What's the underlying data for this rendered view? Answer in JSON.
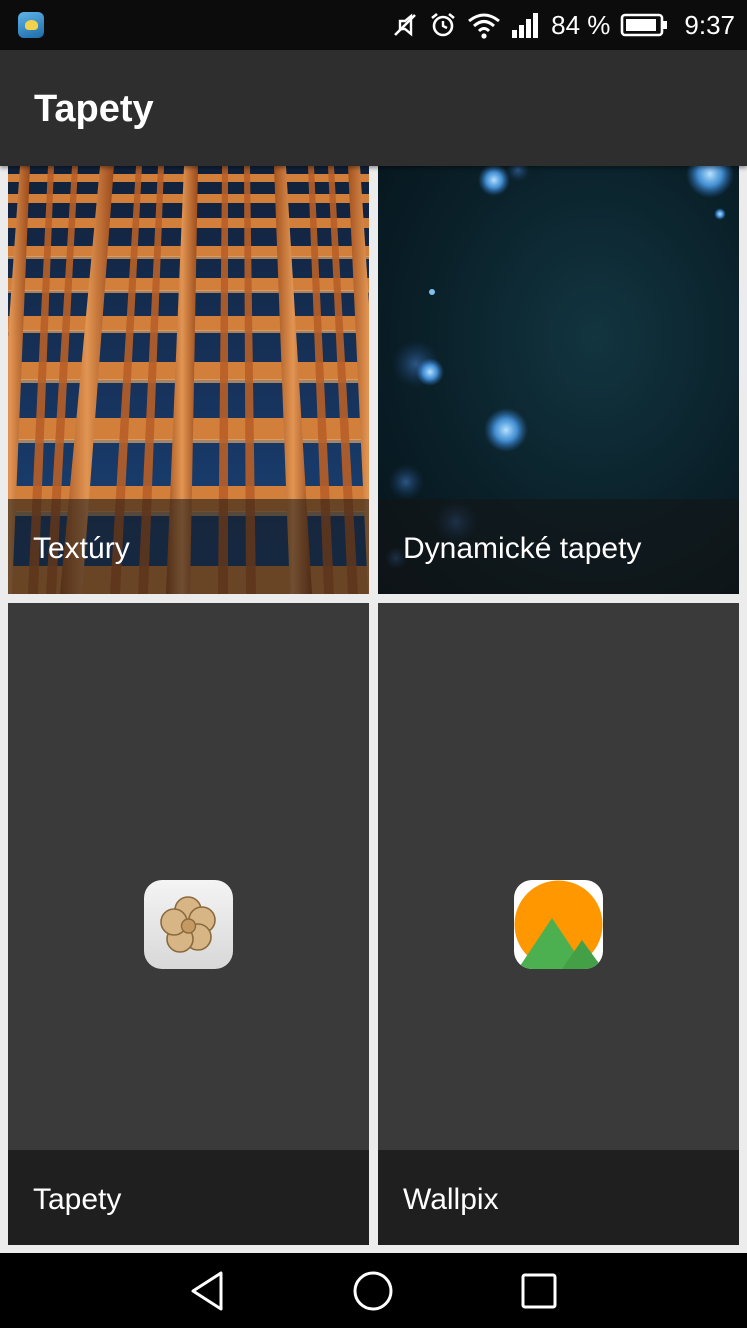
{
  "status_bar": {
    "battery_percent": "84 %",
    "time": "9:37",
    "icons": [
      "weather-app-icon",
      "mute-icon",
      "alarm-icon",
      "wifi-icon",
      "signal-icon",
      "battery-icon"
    ]
  },
  "app_bar": {
    "title": "Tapety"
  },
  "tiles": [
    {
      "label": "Textúry",
      "preview": "building-facade-image"
    },
    {
      "label": "Dynamické tapety",
      "preview": "bokeh-lights-image"
    },
    {
      "label": "Tapety",
      "icon": "huawei-themes-icon"
    },
    {
      "label": "Wallpix",
      "icon": "wallpix-icon"
    }
  ],
  "nav_bar": {
    "buttons": [
      "back-icon",
      "home-icon",
      "recents-icon"
    ]
  },
  "colors": {
    "app_bar": "#2e2e2e",
    "tile_bg": "#3a3a3a",
    "label_bar": "#1f1f1f",
    "background": "#ececec",
    "wallpix_orange": "#ff9800",
    "wallpix_green": "#4caf50"
  }
}
